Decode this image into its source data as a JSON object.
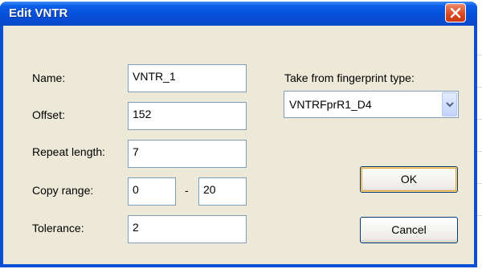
{
  "window": {
    "title": "Edit VNTR",
    "close_icon": "close-icon"
  },
  "form": {
    "name": {
      "label": "Name:",
      "value": "VNTR_1"
    },
    "offset": {
      "label": "Offset:",
      "value": "152"
    },
    "repeat_length": {
      "label": "Repeat length:",
      "value": "7"
    },
    "copy_range": {
      "label": "Copy range:",
      "from": "0",
      "separator": "-",
      "to": "20"
    },
    "tolerance": {
      "label": "Tolerance:",
      "value": "2"
    }
  },
  "fingerprint": {
    "label": "Take from fingerprint type:",
    "selected": "VNTRFprR1_D4"
  },
  "buttons": {
    "ok": "OK",
    "cancel": "Cancel"
  },
  "colors": {
    "title_bar": "#0650d9",
    "client_bg": "#ece9d8",
    "close_button": "#d9461e",
    "field_border": "#7f9db9"
  }
}
